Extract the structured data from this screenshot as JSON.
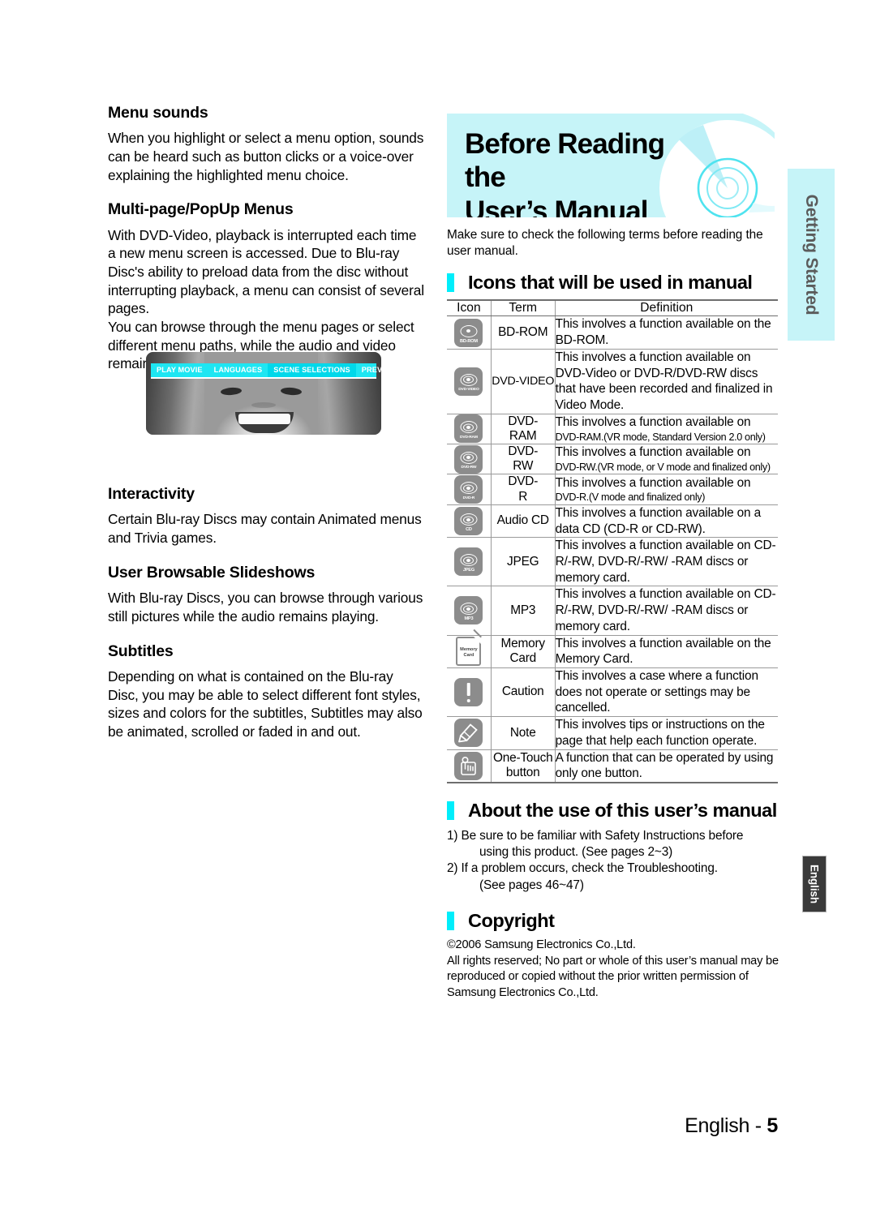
{
  "left_column": {
    "sections": [
      {
        "heading": "Menu sounds",
        "body": "When you highlight or select a menu option, sounds can be heard such as button clicks or a voice-over explaining the highlighted menu choice."
      },
      {
        "heading": "Multi-page/PopUp Menus",
        "body": "With DVD-Video, playback is interrupted each time a new menu screen is accessed. Due to Blu-ray Disc's ability to preload data from the disc without interrupting playback, a menu can consist of several pages.",
        "body2": "You can browse through the menu pages or select different menu paths, while the audio and video remain playing in the background."
      },
      {
        "heading": "Interactivity",
        "body": "Certain Blu-ray Discs may contain Animated menus and Trivia games."
      },
      {
        "heading": "User Browsable Slideshows",
        "body": "With Blu-ray Discs, you can browse through various still pictures while the audio remains playing."
      },
      {
        "heading": "Subtitles",
        "body": "Depending on what is contained on the Blu-ray Disc, you may be able to select different font styles, sizes and colors for the subtitles, Subtitles may also be animated, scrolled or faded in and out."
      }
    ],
    "menu_screenshot": {
      "items": [
        {
          "label": "PLAY MOVIE",
          "active": false
        },
        {
          "label": "LANGUAGES",
          "active": false
        },
        {
          "label": "SCENE SELECTIONS",
          "active": true
        },
        {
          "label": "PREVIEWS",
          "active": false
        }
      ]
    }
  },
  "right_column": {
    "title_line1": "Before Reading the",
    "title_line2": "User’s Manual",
    "intro": "Make sure to check the following terms before reading the user manual.",
    "section_icons_title": "Icons that will be used in manual",
    "section_about_title": "About the use of this user’s manual",
    "section_copyright_title": "Copyright",
    "about_items": [
      {
        "num": "1)",
        "line1": "Be sure to be familiar with Safety Instructions before",
        "line2": "using this product. (See pages 2~3)"
      },
      {
        "num": "2)",
        "line1": "If a problem occurs, check the Troubleshooting.",
        "line2": "(See pages 46~47)"
      }
    ],
    "copyright_lines": [
      "©2006 Samsung Electronics Co.,Ltd.",
      "All rights reserved; No part or whole of this user’s manual may be reproduced or copied without the prior written permission of Samsung Electronics Co.,Ltd."
    ]
  },
  "icon_table": {
    "headers": [
      "Icon",
      "Term",
      "Definition"
    ],
    "rows": [
      {
        "icon_name": "bd-rom-icon",
        "icon_label": "BD-ROM",
        "term": "BD-ROM",
        "definition": "This involves a function available on the BD-ROM.",
        "definition_fine": ""
      },
      {
        "icon_name": "dvd-video-icon",
        "icon_label": "DVD-VIDEO",
        "term": "DVD-VIDEO",
        "definition": "This involves a function available on DVD-Video or DVD-R/DVD-RW discs that have been recorded and finalized in Video Mode.",
        "definition_fine": ""
      },
      {
        "icon_name": "dvd-ram-icon",
        "icon_label": "DVD-RAM",
        "term": "DVD-\nRAM",
        "definition": "This involves a function available on",
        "definition_fine": "DVD-RAM.(VR mode, Standard Version 2.0 only)"
      },
      {
        "icon_name": "dvd-rw-icon",
        "icon_label": "DVD-RW",
        "term": "DVD-\nRW",
        "definition": "This involves a function available  on",
        "definition_fine": "DVD-RW.(VR mode, or V mode and finalized only)"
      },
      {
        "icon_name": "dvd-r-icon",
        "icon_label": "DVD-R",
        "term": "DVD-\nR",
        "definition": "This involves a function available on",
        "definition_fine": "DVD-R.(V mode and finalized only)"
      },
      {
        "icon_name": "audio-cd-icon",
        "icon_label": "CD",
        "term": "Audio CD",
        "definition": "This involves a function available on a data CD (CD-R or CD-RW).",
        "definition_fine": ""
      },
      {
        "icon_name": "jpeg-icon",
        "icon_label": "JPEG",
        "term": "JPEG",
        "definition": "This involves a function available on CD-R/-RW, DVD-R/-RW/ -RAM discs or memory card.",
        "definition_fine": ""
      },
      {
        "icon_name": "mp3-icon",
        "icon_label": "MP3",
        "term": "MP3",
        "definition": "This involves a function available on CD-R/-RW, DVD-R/-RW/ -RAM discs or memory card.",
        "definition_fine": ""
      },
      {
        "icon_name": "memory-card-icon",
        "icon_label": "Memory Card",
        "term": "Memory\nCard",
        "definition": "This involves a function available on the Memory Card.",
        "definition_fine": ""
      },
      {
        "icon_name": "caution-icon",
        "icon_label": "",
        "term": "Caution",
        "definition": "This involves a case where a function does not operate or settings may be cancelled.",
        "definition_fine": ""
      },
      {
        "icon_name": "note-pencil-icon",
        "icon_label": "",
        "term": "Note",
        "definition": "This involves tips or instructions on the page that help each function operate.",
        "definition_fine": ""
      },
      {
        "icon_name": "one-touch-button-icon",
        "icon_label": "",
        "term": "One-Touch\nbutton",
        "definition": "A function that can be operated by using only one button.",
        "definition_fine": ""
      }
    ]
  },
  "side_tabs": {
    "getting_started": "Getting Started",
    "english": "English"
  },
  "footer": {
    "page_label": "English - ",
    "page_number": "5"
  },
  "colors": {
    "banner_cyan": "#c6f4f8",
    "bullet_cyan": "#00eefb",
    "menu_bar_cyan": "#1ee6f2",
    "icon_gray": "#8c8c8c",
    "tab_dark": "#3a3a3a"
  }
}
